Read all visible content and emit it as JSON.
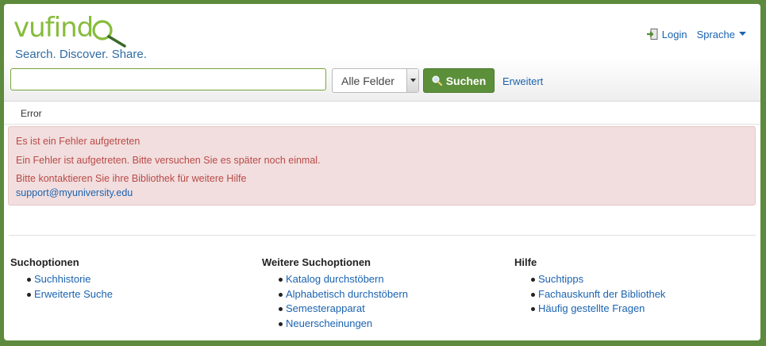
{
  "header": {
    "logo_text": "vufind",
    "tagline": "Search. Discover. Share.",
    "login_label": "Login",
    "language_label": "Sprache"
  },
  "search": {
    "input_value": "",
    "placeholder": "",
    "field_select": "Alle Felder",
    "button_label": "Suchen",
    "advanced_label": "Erweitert"
  },
  "breadcrumb": {
    "current": "Error"
  },
  "error": {
    "heading": "Es ist ein Fehler aufgetreten",
    "message": "Ein Fehler ist aufgetreten. Bitte versuchen Sie es später noch einmal.",
    "contact": "Bitte kontaktieren Sie ihre Bibliothek für weitere Hilfe",
    "email": "support@myuniversity.edu"
  },
  "footer": {
    "columns": [
      {
        "title": "Suchoptionen",
        "links": [
          "Suchhistorie",
          "Erweiterte Suche"
        ]
      },
      {
        "title": "Weitere Suchoptionen",
        "links": [
          "Katalog durchstöbern",
          "Alphabetisch durchstöbern",
          "Semesterapparat",
          "Neuerscheinungen"
        ]
      },
      {
        "title": "Hilfe",
        "links": [
          "Suchtipps",
          "Fachauskunft der Bibliothek",
          "Häufig gestellte Fragen"
        ]
      }
    ]
  },
  "colors": {
    "brand_green": "#86bc3a",
    "button_green": "#5c8f3a",
    "link_blue": "#1a63b0",
    "alert_bg": "#f2dede",
    "alert_text": "#b94a48",
    "frame_green": "#5d8a3c"
  },
  "icons": [
    "magnifier-logo-icon",
    "login-icon",
    "caret-down-icon",
    "search-icon",
    "select-arrow-icon"
  ]
}
